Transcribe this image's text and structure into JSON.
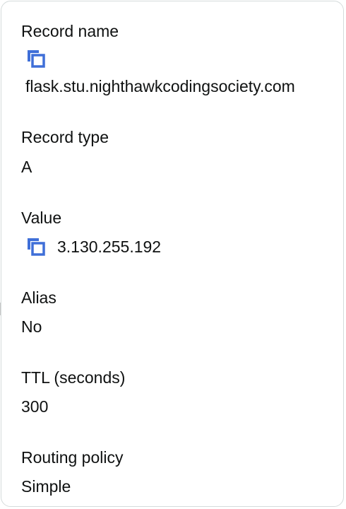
{
  "record": {
    "name_label": "Record name",
    "name_value": "flask.stu.nighthawkcodingsociety.com",
    "type_label": "Record type",
    "type_value": "A",
    "value_label": "Value",
    "value_value": "3.130.255.192",
    "alias_label": "Alias",
    "alias_value": "No",
    "ttl_label": "TTL (seconds)",
    "ttl_value": "300",
    "routing_label": "Routing policy",
    "routing_value": "Simple"
  },
  "icons": {
    "copy": "copy-icon"
  },
  "colors": {
    "icon": "#3f6fd8",
    "text": "#0f1111",
    "border": "#d5dbdb"
  }
}
